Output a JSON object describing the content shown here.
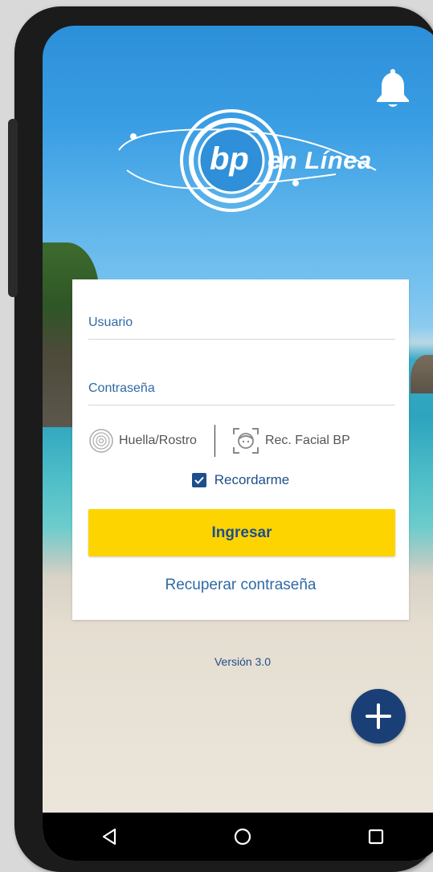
{
  "header": {
    "logo_text": "en Línea",
    "logo_monogram": "bp"
  },
  "login": {
    "username_placeholder": "Usuario",
    "password_placeholder": "Contraseña",
    "biometric_label": "Huella/Rostro",
    "facial_label": "Rec. Facial BP",
    "remember_label": "Recordarme",
    "remember_checked": true,
    "login_button": "Ingresar",
    "recover_link": "Recuperar contraseña"
  },
  "footer": {
    "version": "Versión 3.0"
  },
  "icons": {
    "notification": "bell-icon",
    "fab": "plus-icon",
    "nav": [
      "back-icon",
      "home-icon",
      "recents-icon"
    ]
  },
  "colors": {
    "brand_blue": "#1f4e8c",
    "accent_yellow": "#fdd400",
    "fab_blue": "#1a3f76"
  }
}
